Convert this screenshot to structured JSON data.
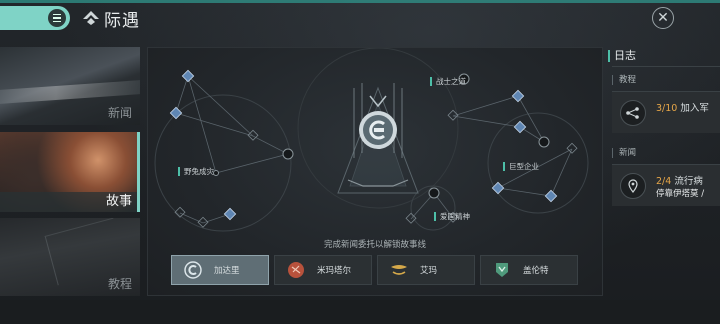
{
  "header": {
    "title": "际遇",
    "close_glyph": "✕"
  },
  "tabs": [
    {
      "label": "新闻",
      "selected": false
    },
    {
      "label": "故事",
      "selected": true
    },
    {
      "label": "教程",
      "selected": false
    }
  ],
  "map": {
    "nodes": {
      "survival": "野兔成灾",
      "warrior_path": "战士之道",
      "megacorp": "巨型企业",
      "patriot": "爱国精神"
    },
    "hint": "完成新闻委托以解锁故事线"
  },
  "characters": [
    {
      "name": "加达里",
      "icon": "caldari-emblem-icon",
      "active": true
    },
    {
      "name": "米玛塔尔",
      "icon": "minmatar-emblem-icon",
      "active": false
    },
    {
      "name": "艾玛",
      "icon": "amarr-emblem-icon",
      "active": false
    },
    {
      "name": "盖伦特",
      "icon": "gallente-emblem-icon",
      "active": false
    }
  ],
  "log": {
    "title": "日志",
    "sections": [
      {
        "label": "教程",
        "progress": "3/10",
        "text": "加入军",
        "sub": ""
      },
      {
        "label": "新闻",
        "progress": "2/4",
        "text": "流行病",
        "sub": "停靠伊塔莫 /"
      }
    ]
  },
  "colors": {
    "accent": "#7fd3c6",
    "progress": "#e6a648",
    "node_fill": "#5f86b3"
  }
}
